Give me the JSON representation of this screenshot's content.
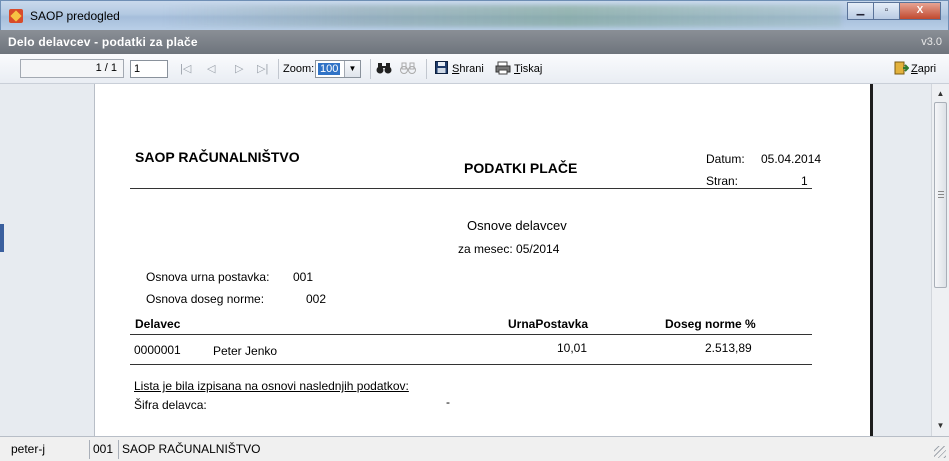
{
  "window": {
    "title": "SAOP predogled",
    "minimize_glyph": "▁",
    "maximize_glyph": "▫",
    "close_glyph": "X"
  },
  "subtitle": {
    "title": "Delo delavcev - podatki za plače",
    "version": "v3.0"
  },
  "toolbar": {
    "page_indicator": "1 / 1",
    "page_input_value": "1",
    "first_glyph": "|◁",
    "prev_glyph": "◁",
    "next_glyph": "▷",
    "last_glyph": "▷|",
    "zoom_label": "Zoom:",
    "zoom_value": "100",
    "zoom_arrow": "▼",
    "find_icon": "binoculars-icon",
    "find_next_icon": "binoculars-outline-icon",
    "save_icon": "floppy-disk-icon",
    "save_label_first": "S",
    "save_label_rest": "hrani",
    "print_icon": "printer-icon",
    "print_label_first": "T",
    "print_label_rest": "iskaj",
    "close_icon": "door-exit-icon",
    "close_label_first": "Z",
    "close_label_rest": "apri"
  },
  "report": {
    "company": "SAOP RAČUNALNIŠTVO",
    "title": "PODATKI PLAČE",
    "datum_label": "Datum:",
    "datum_value": "05.04.2014",
    "stran_label": "Stran:",
    "stran_value": "1",
    "subtitle": "Osnove delavcev",
    "month_line": "za mesec: 05/2014",
    "params": [
      {
        "label": "Osnova urna postavka:",
        "value": "001"
      },
      {
        "label": "Osnova doseg norme:",
        "value": "002"
      }
    ],
    "columns": {
      "delavec": "Delavec",
      "urna": "UrnaPostavka",
      "doseg": "Doseg norme %"
    },
    "rows": [
      {
        "code": "0000001",
        "name": "Peter Jenko",
        "urna": "10,01",
        "doseg": "2.513,89"
      }
    ],
    "note": "Lista je bila izpisana na osnovi naslednjih podatkov:",
    "sifra_label": "Šifra delavca:",
    "sifra_value": "-"
  },
  "statusbar": {
    "user": "peter-j",
    "company_code": "001",
    "company_name": "SAOP RAČUNALNIŠTVO"
  },
  "scrollbar": {
    "up_glyph": "▲",
    "down_glyph": "▼",
    "position": 0.0
  }
}
